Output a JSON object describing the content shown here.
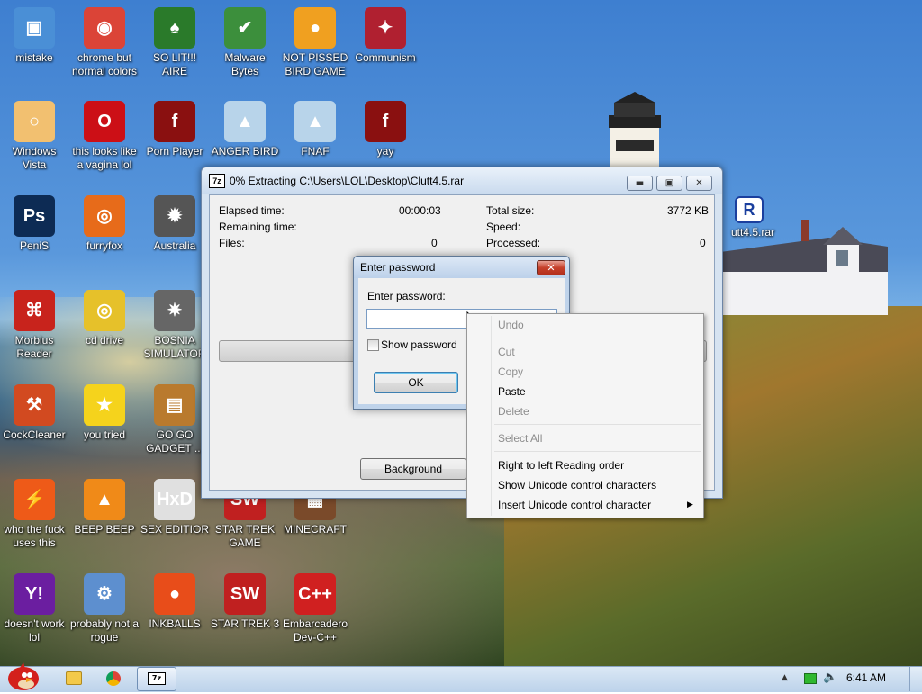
{
  "desktop_icons": [
    {
      "label": "mistake",
      "icon": "monitor-icon",
      "color": "#4a8fd6"
    },
    {
      "label": "chrome but normal colors",
      "icon": "chrome-icon",
      "color": "#db4437"
    },
    {
      "label": "SO LIT!!! AIRE",
      "icon": "cards-icon",
      "color": "#2a7a2a"
    },
    {
      "label": "Malware Bytes",
      "icon": "shield-icon",
      "color": "#3c8f3c"
    },
    {
      "label": "NOT PISSED BIRD GAME",
      "icon": "green-pig-icon",
      "color": "#f0a020"
    },
    {
      "label": "Communism",
      "icon": "winged-shield-icon",
      "color": "#b02030"
    },
    {
      "label": "Windows Vista",
      "icon": "egg-icon",
      "color": "#f2c070"
    },
    {
      "label": "this looks like a vagina lol",
      "icon": "opera-icon",
      "color": "#cc0f16"
    },
    {
      "label": "Porn Player",
      "icon": "flash-icon",
      "color": "#8a1010"
    },
    {
      "label": "ANGER BIRD",
      "icon": "red-bird-icon",
      "color": "#b8d4ea"
    },
    {
      "label": "FNAF",
      "icon": "red-bird-icon",
      "color": "#b8d4ea"
    },
    {
      "label": "yay",
      "icon": "flash-icon",
      "color": "#8a1010"
    },
    {
      "label": "PeniS",
      "icon": "photoshop-icon",
      "color": "#0d2b54"
    },
    {
      "label": "furryfox",
      "icon": "firefox-icon",
      "color": "#e76b1a"
    },
    {
      "label": "Australia",
      "icon": "spider-icon",
      "color": "#555555"
    },
    {
      "label": "Morbius Reader",
      "icon": "pdf-icon",
      "color": "#c8231c"
    },
    {
      "label": "cd drive",
      "icon": "cd-icon",
      "color": "#e6c12a"
    },
    {
      "label": "BOSNIA SIMULATOR",
      "icon": "mine-icon",
      "color": "#666666"
    },
    {
      "label": "CockCleaner",
      "icon": "broom-icon",
      "color": "#d24a20"
    },
    {
      "label": "you tried",
      "icon": "star-icon",
      "color": "#f5d31c"
    },
    {
      "label": "GO GO GADGET ...",
      "icon": "briefcase-icon",
      "color": "#b97a2e"
    },
    {
      "label": "who the fuck uses this",
      "icon": "lightning-icon",
      "color": "#ee5a18"
    },
    {
      "label": "BEEP BEEP",
      "icon": "vlc-cone-icon",
      "color": "#f08a18"
    },
    {
      "label": "SEX EDITIOR",
      "icon": "hxd-icon",
      "color": "#e0e0e0"
    },
    {
      "label": "STAR TREK GAME",
      "icon": "star-wars-icon",
      "color": "#c02020"
    },
    {
      "label": "MINECRAFT",
      "icon": "minecraft-icon",
      "color": "#7a4a2a"
    },
    {
      "label": "doesn't work lol",
      "icon": "yahoo-icon",
      "color": "#6b1ea0"
    },
    {
      "label": "probably not a rogue",
      "icon": "gears-icon",
      "color": "#5d8fcf"
    },
    {
      "label": "INKBALLS",
      "icon": "ink-ball-icon",
      "color": "#e84d1a"
    },
    {
      "label": "STAR TREK 3",
      "icon": "star-wars-icon",
      "color": "#c02020"
    },
    {
      "label": "Embarcadero Dev-C++",
      "icon": "devcpp-icon",
      "color": "#d02020"
    }
  ],
  "behind_file": {
    "label": "utt4.5.rar",
    "icon": "rar-icon"
  },
  "extract_window": {
    "icon": "7z",
    "title": "0% Extracting C:\\Users\\LOL\\Desktop\\Clutt4.5.rar",
    "elapsed_label": "Elapsed time:",
    "elapsed_value": "00:00:03",
    "remaining_label": "Remaining time:",
    "files_label": "Files:",
    "files_value": "0",
    "total_size_label": "Total size:",
    "total_size_value": "3772 KB",
    "speed_label": "Speed:",
    "processed_label": "Processed:",
    "processed_value": "0",
    "progress_fraction": 0.0,
    "background_button": "Background"
  },
  "password_dialog": {
    "title": "Enter password",
    "prompt": "Enter password:",
    "input_value": "",
    "show_password_label": "Show password",
    "show_password_checked": false,
    "ok_label": "OK"
  },
  "context_menu": {
    "undo": "Undo",
    "cut": "Cut",
    "copy": "Copy",
    "paste": "Paste",
    "delete": "Delete",
    "select_all": "Select All",
    "rtl": "Right to left Reading order",
    "show_unicode": "Show Unicode control characters",
    "insert_unicode": "Insert Unicode control character"
  },
  "taskbar": {
    "start_icon": "red-bird-icon",
    "pinned": [
      "explorer-icon",
      "chrome-icon",
      "7z-icon"
    ],
    "active_app": "7z",
    "clock": "6:41 AM"
  }
}
